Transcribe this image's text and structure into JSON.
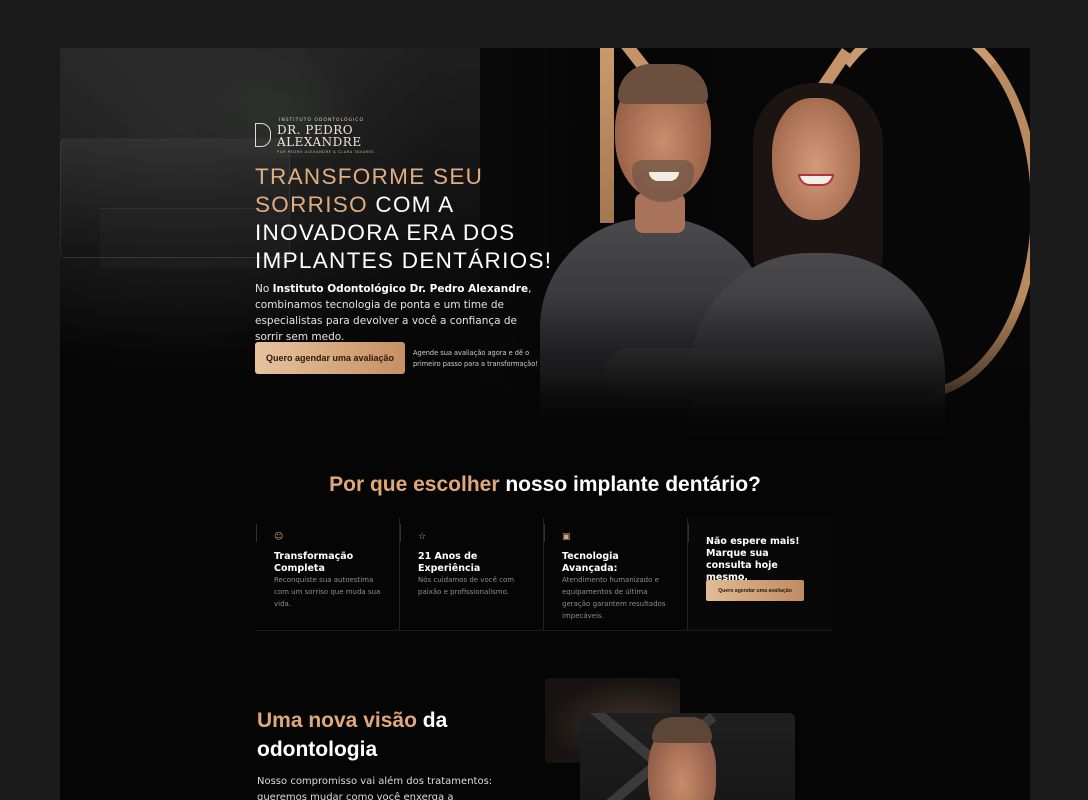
{
  "brand": {
    "top_line": "INSTITUTO ODONTOLÓGICO",
    "name_line1": "DR. PEDRO",
    "name_line2": "ALEXANDRE",
    "sub_line": "POR PEDRO ALEXANDRE & CLARA TAVARES"
  },
  "hero": {
    "headline_gold": "TRANSFORME SEU SORRISO",
    "headline_white": " COM A INOVADORA ERA DOS IMPLANTES DENTÁRIOS!",
    "lead_prefix": "No ",
    "lead_bold": "Instituto Odontológico Dr. Pedro Alexandre",
    "lead_suffix": ", combinamos tecnologia de ponta e um time de especialistas para devolver a você a confiança de sorrir sem medo.",
    "cta_label": "Quero agendar uma avaliação",
    "cta_note": "Agende sua avaliação agora e dê o primeiro passo para a transformação!"
  },
  "why": {
    "title_gold": "Por que escolher",
    "title_white": " nosso implante dentário?",
    "features": [
      {
        "icon": "smile-icon",
        "glyph": "☺",
        "title": "Transformação Completa",
        "text": "Reconquiste sua autoestima com um sorriso que muda sua vida."
      },
      {
        "icon": "star-icon",
        "glyph": "☆",
        "title": "21 Anos de Experiência",
        "text": "Nós cuidamos de você com paixão e profissionalismo."
      },
      {
        "icon": "chip-icon",
        "glyph": "▣",
        "title": "Tecnologia Avançada:",
        "text": "Atendimento humanizado e equipamentos de última geração garantem resultados impecáveis."
      }
    ],
    "cta_box": {
      "title": "Não espere mais! Marque sua consulta hoje mesmo.",
      "button": "Quero agendar uma avaliação"
    }
  },
  "vision": {
    "title_gold": "Uma nova visão",
    "title_white": " da odontologia",
    "text": "Nosso compromisso vai além dos tratamentos: queremos mudar como você enxerga a odontologia."
  },
  "colors": {
    "gold": "#dfae82",
    "background": "#050505",
    "page": "#1b1b1c"
  }
}
